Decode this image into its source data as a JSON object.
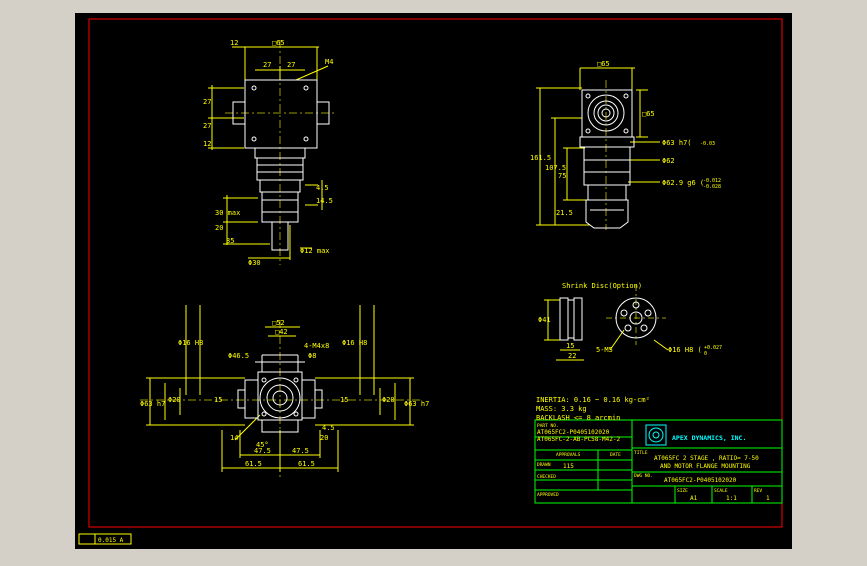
{
  "colors": {
    "background": "#d4d0c8",
    "canvas": "#000000",
    "frame": "#ff0000",
    "geometry": "#ffffff",
    "dimension": "#ffff00",
    "titleblock": "#00ff00",
    "logo": "#00ffff"
  },
  "top_view": {
    "dims": [
      "12",
      "□65",
      "27",
      "27",
      "M4",
      "27",
      "27",
      "12",
      "30 max",
      "20",
      "35",
      "Φ12 max",
      "Φ30",
      "4.5",
      "14.5"
    ]
  },
  "side_view": {
    "dims": [
      "□65",
      "□65",
      "Φ63 h7(",
      "-0.03",
      "Φ62",
      "Φ62.9 g6 (",
      "-0.012",
      "-0.028",
      "161.5",
      "107.5",
      "75",
      "21.5"
    ]
  },
  "shrink_disc": {
    "title": "Shrink Disc(Option)",
    "dims": [
      "Φ41",
      "15",
      "22",
      "5-M5",
      "Φ16 H8 (",
      "+0.027",
      "0"
    ]
  },
  "front_view": {
    "dims": [
      "□52",
      "□42",
      "Φ46.5",
      "4-M4x8",
      "Φ8",
      "Φ16 H8",
      "Φ16 H8",
      "Φ63 h7",
      "Φ63 h7",
      "Φ20",
      "Φ20",
      "15",
      "15",
      "14",
      "45°",
      "47.5",
      "47.5",
      "61.5",
      "61.5",
      "20",
      "4.5"
    ]
  },
  "specs": {
    "inertia": "INERTIA: 0.16 ~ 0.16  kg-cm²",
    "mass": "MASS: 3.3 kg",
    "backlash": "BACKLASH <= 8 arcmin"
  },
  "titleblock": {
    "part_no_label": "PART NO.",
    "part_no_1": "AT065FC2-P0405102020",
    "part_no_2": "AT065FC-2-AB-PC58-M42-2",
    "approvals": "APPROVALS",
    "date": "DATE",
    "drawn": "DRAWN",
    "drawn_by": "115",
    "checked": "CHECKED",
    "approved": "APPROVED",
    "company": "APEX DYNAMICS, INC.",
    "title_label": "TITLE",
    "title_line1": "AT065FC 2 STAGE , RATIO= 7-50",
    "title_line2": "AND MOTOR FLANGE MOUNTING",
    "dwg_no_label": "DWG NO.",
    "dwg_no": "AT065FC2-P0405102020",
    "size_label": "SIZE",
    "size": "A1",
    "scale_label": "SCALE",
    "scale": "1:1",
    "rev_label": "REV",
    "rev": "1"
  },
  "footer": {
    "tag": "0.015 A"
  }
}
